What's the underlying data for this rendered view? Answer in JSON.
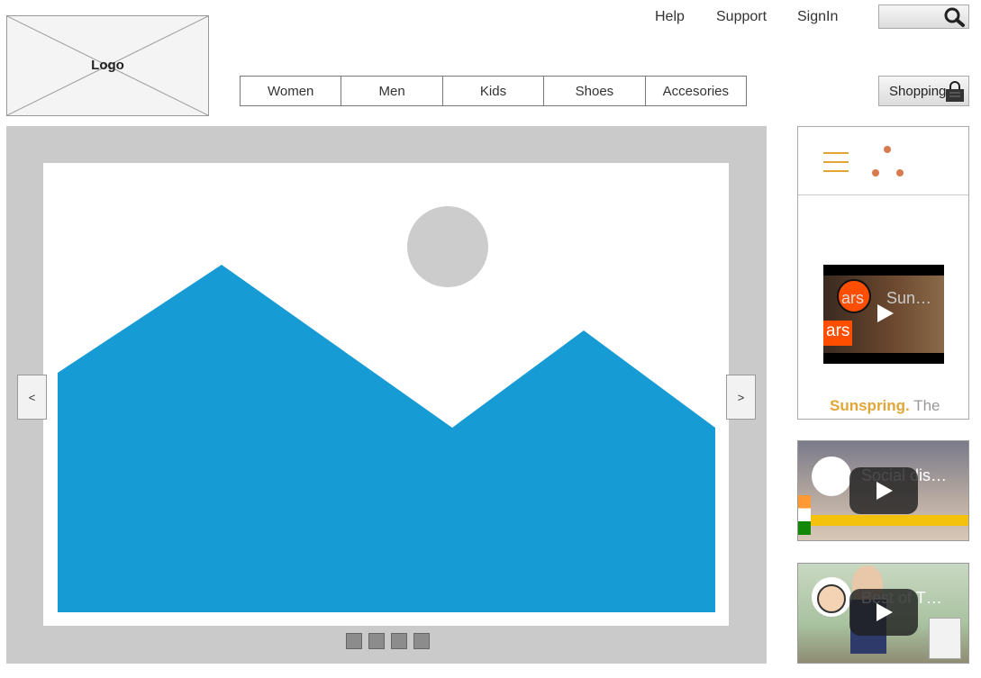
{
  "logo": {
    "label": "Logo"
  },
  "header": {
    "links": {
      "help": "Help",
      "support": "Support",
      "signin": "SignIn"
    },
    "shopping_label": "Shopping"
  },
  "nav": {
    "items": [
      "Women",
      "Men",
      "Kids",
      "Shoes",
      "Accesories"
    ]
  },
  "carousel": {
    "prev_label": "<",
    "next_label": ">",
    "indicator_count": 4,
    "colors": {
      "background": "#cacaca",
      "mountain": "#179bd4",
      "sun": "#cccccc"
    }
  },
  "sidebar": {
    "embed1": {
      "badge": "ars",
      "video_title": "Sun…",
      "caption_bold": "Sunspring.",
      "caption_rest": "The",
      "accent": "#e0a636"
    },
    "video2": {
      "title": "Social dis…"
    },
    "video3": {
      "title": "Best of T…"
    }
  }
}
